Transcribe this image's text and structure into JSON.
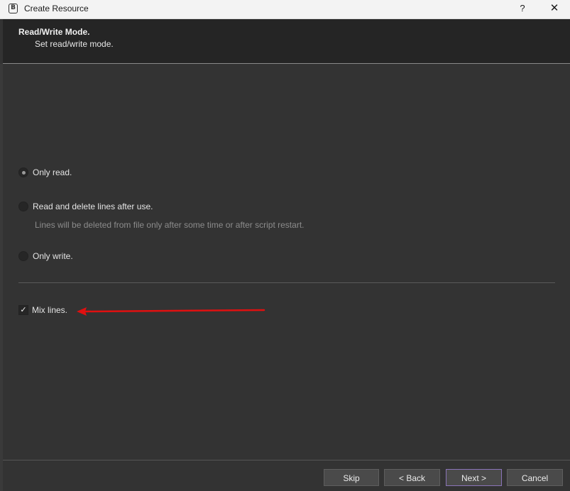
{
  "window": {
    "title": "Create Resource",
    "help_label": "?",
    "close_label": "✕",
    "app_icon_glyph": "B"
  },
  "header": {
    "title": "Read/Write Mode.",
    "subtitle": "Set read/write mode."
  },
  "options": {
    "only_read": {
      "label": "Only read.",
      "checked": true
    },
    "read_delete": {
      "label": "Read and delete lines after use.",
      "checked": false,
      "hint": "Lines will be deleted from file only after some time or after script restart."
    },
    "only_write": {
      "label": "Only write.",
      "checked": false
    }
  },
  "mix_lines": {
    "label": "Mix lines.",
    "checked": true,
    "check_glyph": "✓"
  },
  "annotation": {
    "arrow_color": "#e01010"
  },
  "footer": {
    "skip_label": "Skip",
    "back_label": "< Back",
    "next_label": "Next >",
    "cancel_label": "Cancel"
  },
  "colors": {
    "background": "#333333",
    "header_bg": "#252525",
    "primary_button_border": "#8a74b8"
  }
}
